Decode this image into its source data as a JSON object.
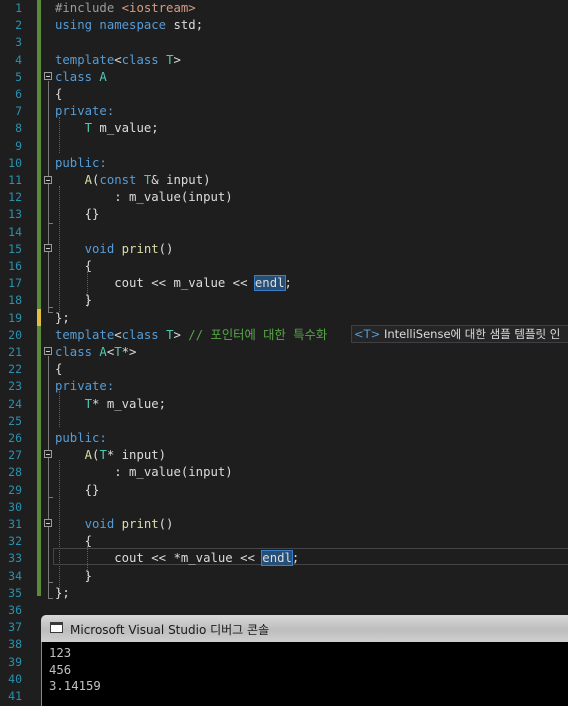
{
  "editor": {
    "line_numbers": [
      "1",
      "2",
      "3",
      "4",
      "5",
      "6",
      "7",
      "8",
      "9",
      "10",
      "11",
      "12",
      "13",
      "14",
      "15",
      "16",
      "17",
      "18",
      "19",
      "20",
      "21",
      "22",
      "23",
      "24",
      "25",
      "26",
      "27",
      "28",
      "29",
      "30",
      "31",
      "32",
      "33",
      "34",
      "35",
      "36",
      "37",
      "38",
      "39",
      "40",
      "41"
    ],
    "lines": {
      "l1_a": "#include ",
      "l1_b": "<iostream>",
      "l2_a": "using",
      "l2_b": " namespace",
      "l2_c": " std;",
      "l4_a": "template",
      "l4_b": "<",
      "l4_c": "class",
      "l4_d": " T",
      "l4_e": ">",
      "l5_a": "class",
      "l5_b": " A",
      "l6": "{",
      "l7": "private:",
      "l8_a": "    T",
      "l8_b": " m_value;",
      "l10": "public:",
      "l11_a": "    A",
      "l11_b": "(",
      "l11_c": "const",
      "l11_d": " T",
      "l11_e": "& input)",
      "l12": "        : m_value(input)",
      "l13": "    {}",
      "l15_a": "    void",
      "l15_b": " print",
      "l15_c": "()",
      "l16": "    {",
      "l17_a": "        cout << m_value << ",
      "l17_b": "endl",
      "l17_c": ";",
      "l18": "    }",
      "l19": "};",
      "l20_a": "template",
      "l20_b": "<",
      "l20_c": "class",
      "l20_d": " T",
      "l20_e": "> ",
      "l20_f": "// 포인터에 대한 특수화",
      "l21_a": "class",
      "l21_b": " A",
      "l21_c": "<",
      "l21_d": "T",
      "l21_e": "*>",
      "l22": "{",
      "l23": "private:",
      "l24_a": "    T",
      "l24_b": "* m_value;",
      "l26": "public:",
      "l27_a": "    A",
      "l27_b": "(",
      "l27_c": "T",
      "l27_d": "* input)",
      "l28": "        : m_value(input)",
      "l29": "    {}",
      "l31_a": "    void",
      "l31_b": " print",
      "l31_c": "()",
      "l32": "    {",
      "l33_a": "        cout << *m_value << ",
      "l33_b": "endl",
      "l33_c": ";",
      "l34": "    }",
      "l35": "};"
    },
    "hint": {
      "tag": "<T>",
      "text": " IntelliSense에 대한 샘플 템플릿 인"
    },
    "colors": {
      "keyword": "#569cd6",
      "type": "#4ec9b0",
      "function": "#dcdcaa",
      "comment": "#57a64a",
      "include_path": "#d69d85",
      "line_number": "#2b91af",
      "background": "#1e1e1e"
    }
  },
  "console": {
    "title": "Microsoft Visual Studio 디버그 콘솔",
    "icon": "console-window-icon",
    "output": [
      "123",
      "456",
      "3.14159"
    ]
  }
}
